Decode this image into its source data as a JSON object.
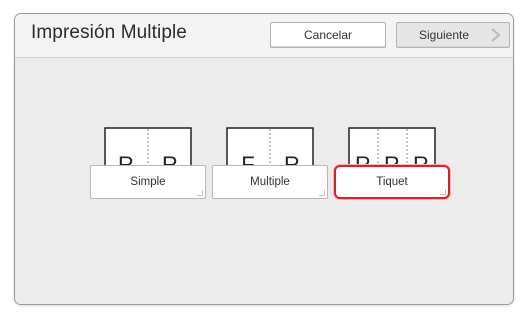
{
  "header": {
    "title": "Impresión Multiple",
    "cancel_label": "Cancelar",
    "next_label": "Siguiente"
  },
  "options": [
    {
      "label": "Simple",
      "icon_letters": [
        "R",
        "R"
      ],
      "selected": false
    },
    {
      "label": "Multiple",
      "icon_letters": [
        "F",
        "R"
      ],
      "selected": false
    },
    {
      "label": "Tiquet",
      "icon_letters": [
        "R",
        "R",
        "R"
      ],
      "selected": true
    }
  ],
  "colors": {
    "selection": "#d2222c",
    "panel_background": "#ececec"
  }
}
